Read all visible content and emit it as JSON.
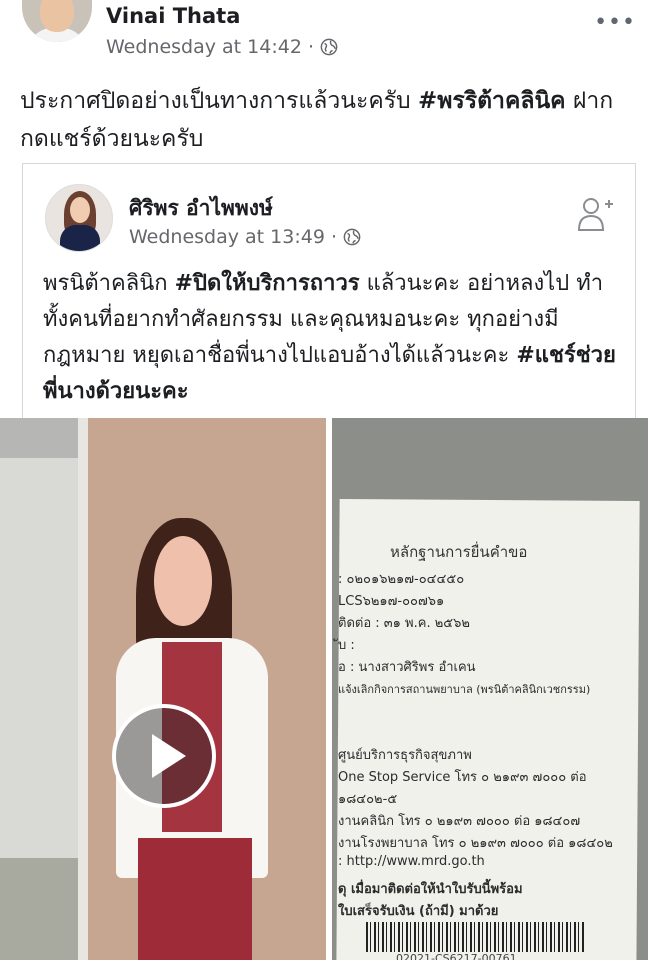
{
  "post": {
    "author": "Vinai Thata",
    "time": "Wednesday at 14:42",
    "separator": "·",
    "more": "•••",
    "text_before": "ประกาศปิดอย่างเป็นทางการแล้วนะครับ ",
    "hashtag": "#พรริต้าคลินิค",
    "text_after": " ฝาก กดแชร์ด้วยนะครับ"
  },
  "shared": {
    "author": "ศิริพร อำไพพงษ์",
    "time": "Wednesday at 13:49",
    "separator": "·",
    "text_1": "พรนิต้าคลินิก ",
    "hashtag_1": "#ปิดให้บริการถาวร",
    "text_2": " แล้วนะคะ อย่าหลงไป ทำ ทั้งคนที่อยากทำศัลยกรรม และคุณหมอนะคะ ทุกอย่างมีกฎหมาย หยุดเอาชื่อพี่นางไปแอบอ้างได้แล้วนะคะ ",
    "hashtag_2": "#แชร์ช่วยพี่นางด้วยนะคะ"
  },
  "document": {
    "title": "หลักฐานการยื่นคำขอ",
    "lines": [
      ":     ๐๒๐๑๖๒๑๗-๐๔๔๕๐",
      "        LCS๖๒๑๗-๐๐๗๖๑",
      "ติดต่อ :  ๓๑  พ.ค.  ๒๕๖๒",
      "ับ :",
      "อ :   นางสาวศิริพร  อำเคน",
      "        แจ้งเลิกกิจการสถานพยาบาล (พรนิต้าคลินิกเวชกรรม)",
      "        ศูนย์บริการธุรกิจสุขภาพ",
      "        One Stop Service โทร ๐ ๒๑๙๓ ๗๐๐๐ ต่อ",
      "        ๑๘๔๐๒-๕",
      "        งานคลินิก โทร ๐ ๒๑๙๓ ๗๐๐๐ ต่อ ๑๘๔๐๗",
      "        งานโรงพยาบาล โทร ๐ ๒๑๙๓ ๗๐๐๐ ต่อ ๑๘๔๐๒",
      ":      http://www.mrd.go.th",
      "ดุ     เมื่อมาติดต่อให้นำใบรับนี้พร้อม",
      "        ใบเสร็จรับเงิน (ถ้ามี) มาด้วย"
    ],
    "barcode_text": "02021-CS6217-00761"
  },
  "icons": {
    "globe": "globe-icon",
    "add_friend": "add-friend-icon",
    "play": "play-icon",
    "more": "more-icon"
  }
}
